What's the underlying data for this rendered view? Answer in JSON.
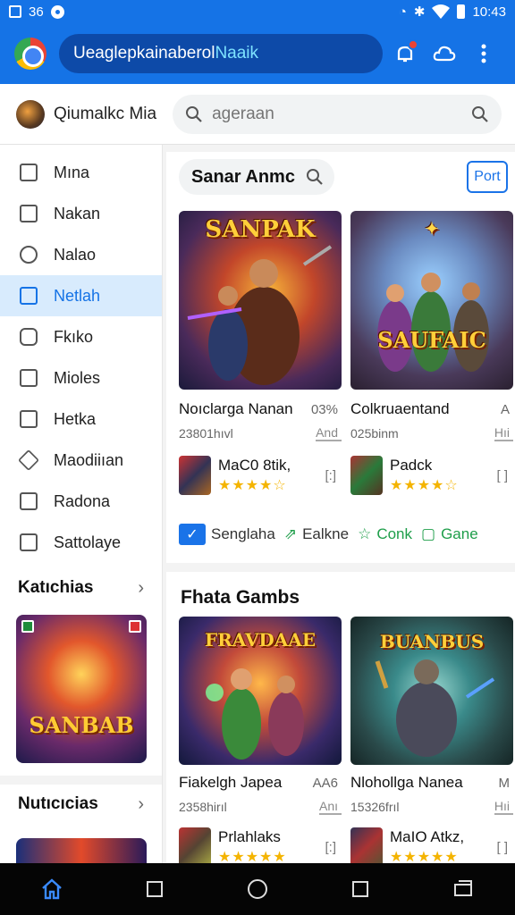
{
  "status_bar": {
    "left_text": "36",
    "time": "10:43"
  },
  "app_bar": {
    "url_main": "Ueaglepkainaberol",
    "url_highlight": "Naaik"
  },
  "sub_header": {
    "profile_name": "Qiumalkc Mia",
    "search_placeholder": "ageraan"
  },
  "sidebar": {
    "items": [
      {
        "label": "Mına",
        "icon": "home-icon"
      },
      {
        "label": "Nakan",
        "icon": "grid-icon"
      },
      {
        "label": "Nalao",
        "icon": "person-icon"
      },
      {
        "label": "Netlah",
        "icon": "square-icon",
        "active": true
      },
      {
        "label": "Fkıko",
        "icon": "tag-icon"
      },
      {
        "label": "Mioles",
        "icon": "square-icon"
      },
      {
        "label": "Hetka",
        "icon": "image-icon"
      },
      {
        "label": "Maodiiıan",
        "icon": "diamond-icon"
      },
      {
        "label": "Radona",
        "icon": "square-icon"
      },
      {
        "label": "Sattolaye",
        "icon": "square-icon"
      }
    ],
    "section1_title": "Katıchias",
    "card1_title": "SANBAB",
    "section2_title": "Nutıcıcias"
  },
  "panel1": {
    "title": "Sanar Anmc",
    "button_label": "Port",
    "games": [
      {
        "cover_title": "SANPAK",
        "title": "Noıclarga Nanan",
        "meta": "03%",
        "sub": "23801hıvl",
        "tag": "And",
        "mini_name": "MaC0 8tik,",
        "mini_action": "[:]",
        "stars": "★★★★☆"
      },
      {
        "cover_title": "SAUFAIC",
        "title": "Colkruaentand",
        "meta": "A",
        "sub": "025binm",
        "tag": "Hıi",
        "mini_name": "Padck",
        "mini_action": "[ ]",
        "stars": "★★★★☆"
      }
    ],
    "actions": [
      "Senglaha",
      "Ealkne",
      "Conk",
      "Gane"
    ]
  },
  "panel2": {
    "title": "Fhata Gambs",
    "games": [
      {
        "cover_title": "FRAVDAAE",
        "title": "Fiakelgh Japea",
        "meta": "AA6",
        "sub": "2358hirıl",
        "tag": "Anı",
        "mini_name": "Prlahlaks",
        "mini_action": "[:]",
        "stars": "★★★★★"
      },
      {
        "cover_title": "BUANBUS",
        "title": "Nlohollga Nanea",
        "meta": "M",
        "sub": "15326frıl",
        "tag": "Hıi",
        "mini_name": "MaIO Atkz,",
        "mini_action": "[ ]",
        "stars": "★★★★★"
      }
    ]
  },
  "colors": {
    "primary": "#1573e6",
    "accent_green": "#1e9e4a",
    "star": "#f4b400"
  }
}
